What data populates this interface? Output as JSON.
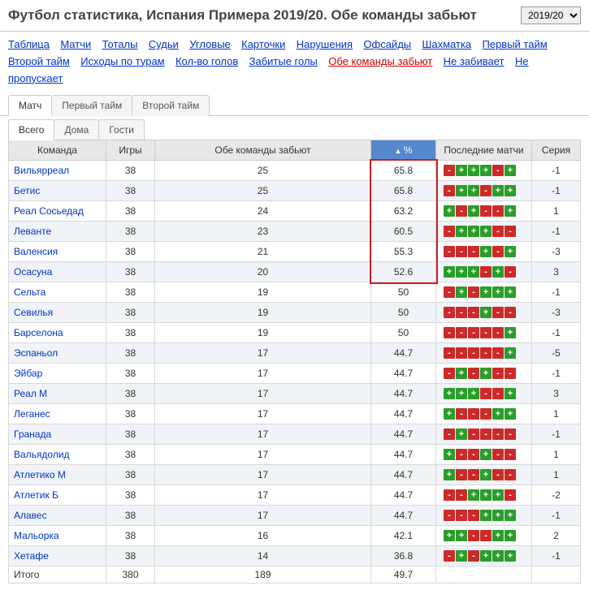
{
  "header": {
    "title": "Футбол статистика, Испания Примера 2019/20. Обе команды забьют",
    "season": "2019/20"
  },
  "links": [
    "Таблица",
    "Матчи",
    "Тоталы",
    "Судьи",
    "Угловые",
    "Карточки",
    "Нарушения",
    "Офсайды",
    "Шахматка",
    "Первый тайм",
    "Второй тайм",
    "Исходы по турам",
    "Кол-во голов",
    "Забитые голы",
    "Обе команды забьют",
    "Не забивает",
    "Не пропускает"
  ],
  "active_link_index": 14,
  "tabs1": [
    "Матч",
    "Первый тайм",
    "Второй тайм"
  ],
  "tabs1_active": 0,
  "tabs2": [
    "Всего",
    "Дома",
    "Гости"
  ],
  "tabs2_active": 0,
  "columns": {
    "team": "Команда",
    "games": "Игры",
    "both": "Обе команды забьют",
    "pct": "%",
    "recent": "Последние матчи",
    "streak": "Серия"
  },
  "rows": [
    {
      "team": "Вильярреал",
      "g": 38,
      "b": 25,
      "p": "65.8",
      "r": [
        "-",
        "+",
        "+",
        "+",
        "-",
        "+"
      ],
      "s": "-1"
    },
    {
      "team": "Бетис",
      "g": 38,
      "b": 25,
      "p": "65.8",
      "r": [
        "-",
        "+",
        "+",
        "-",
        "+",
        "+"
      ],
      "s": "-1"
    },
    {
      "team": "Реал Сосьедад",
      "g": 38,
      "b": 24,
      "p": "63.2",
      "r": [
        "+",
        "-",
        "+",
        "-",
        "-",
        "+"
      ],
      "s": "1"
    },
    {
      "team": "Леванте",
      "g": 38,
      "b": 23,
      "p": "60.5",
      "r": [
        "-",
        "+",
        "+",
        "+",
        "-",
        "-"
      ],
      "s": "-1"
    },
    {
      "team": "Валенсия",
      "g": 38,
      "b": 21,
      "p": "55.3",
      "r": [
        "-",
        "-",
        "-",
        "+",
        "-",
        "+"
      ],
      "s": "-3"
    },
    {
      "team": "Осасуна",
      "g": 38,
      "b": 20,
      "p": "52.6",
      "r": [
        "+",
        "+",
        "+",
        "-",
        "+",
        "-"
      ],
      "s": "3"
    },
    {
      "team": "Сельта",
      "g": 38,
      "b": 19,
      "p": "50",
      "r": [
        "-",
        "+",
        "-",
        "+",
        "+",
        "+"
      ],
      "s": "-1"
    },
    {
      "team": "Севилья",
      "g": 38,
      "b": 19,
      "p": "50",
      "r": [
        "-",
        "-",
        "-",
        "+",
        "-",
        "-"
      ],
      "s": "-3"
    },
    {
      "team": "Барселона",
      "g": 38,
      "b": 19,
      "p": "50",
      "r": [
        "-",
        "-",
        "-",
        "-",
        "-",
        "+"
      ],
      "s": "-1"
    },
    {
      "team": "Эспаньол",
      "g": 38,
      "b": 17,
      "p": "44.7",
      "r": [
        "-",
        "-",
        "-",
        "-",
        "-",
        "+"
      ],
      "s": "-5"
    },
    {
      "team": "Эйбар",
      "g": 38,
      "b": 17,
      "p": "44.7",
      "r": [
        "-",
        "+",
        "-",
        "+",
        "-",
        "-"
      ],
      "s": "-1"
    },
    {
      "team": "Реал М",
      "g": 38,
      "b": 17,
      "p": "44.7",
      "r": [
        "+",
        "+",
        "+",
        "-",
        "-",
        "+"
      ],
      "s": "3"
    },
    {
      "team": "Леганес",
      "g": 38,
      "b": 17,
      "p": "44.7",
      "r": [
        "+",
        "-",
        "-",
        "-",
        "+",
        "+"
      ],
      "s": "1"
    },
    {
      "team": "Гранада",
      "g": 38,
      "b": 17,
      "p": "44.7",
      "r": [
        "-",
        "+",
        "-",
        "-",
        "-",
        "-"
      ],
      "s": "-1"
    },
    {
      "team": "Вальядолид",
      "g": 38,
      "b": 17,
      "p": "44.7",
      "r": [
        "+",
        "-",
        "-",
        "+",
        "-",
        "-"
      ],
      "s": "1"
    },
    {
      "team": "Атлетико М",
      "g": 38,
      "b": 17,
      "p": "44.7",
      "r": [
        "+",
        "-",
        "-",
        "+",
        "-",
        "-"
      ],
      "s": "1"
    },
    {
      "team": "Атлетик Б",
      "g": 38,
      "b": 17,
      "p": "44.7",
      "r": [
        "-",
        "-",
        "+",
        "+",
        "+",
        "-"
      ],
      "s": "-2"
    },
    {
      "team": "Алавес",
      "g": 38,
      "b": 17,
      "p": "44.7",
      "r": [
        "-",
        "-",
        "-",
        "+",
        "+",
        "+"
      ],
      "s": "-1"
    },
    {
      "team": "Мальорка",
      "g": 38,
      "b": 16,
      "p": "42.1",
      "r": [
        "+",
        "+",
        "-",
        "-",
        "+",
        "+"
      ],
      "s": "2"
    },
    {
      "team": "Хетафе",
      "g": 38,
      "b": 14,
      "p": "36.8",
      "r": [
        "-",
        "+",
        "-",
        "+",
        "+",
        "+"
      ],
      "s": "-1"
    }
  ],
  "total": {
    "team": "Итого",
    "g": 380,
    "b": 189,
    "p": "49.7"
  },
  "highlight": {
    "top": 0,
    "height": 6
  }
}
